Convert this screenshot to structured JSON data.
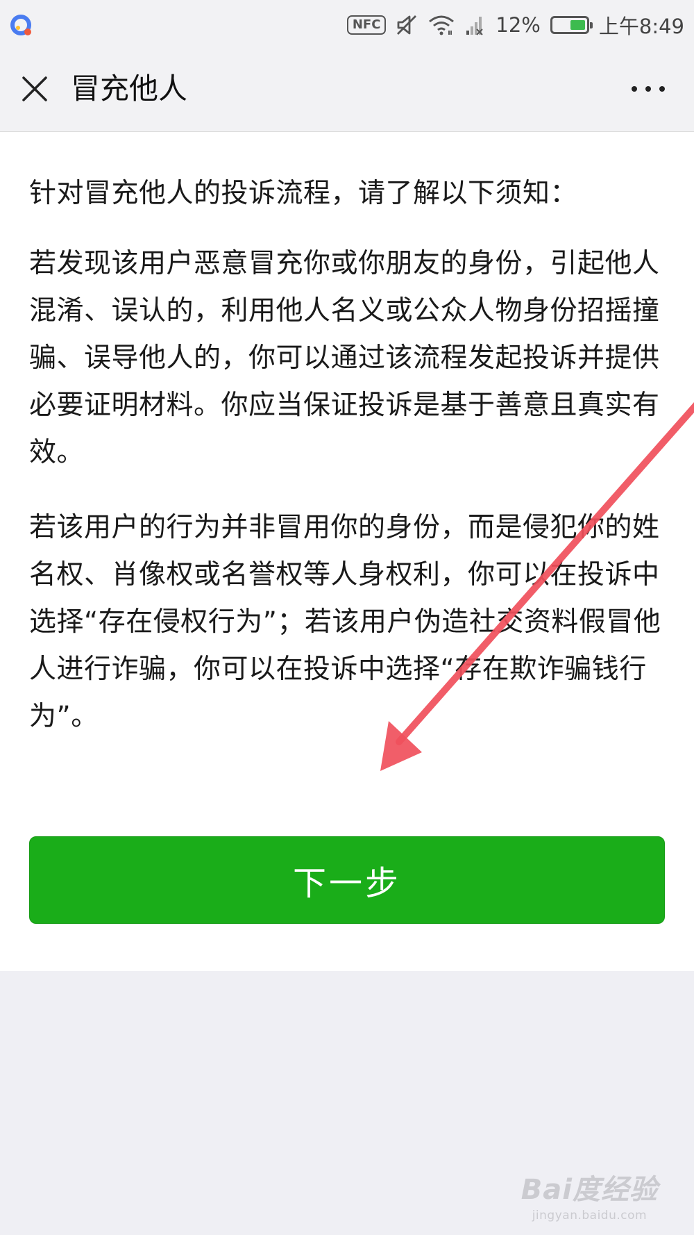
{
  "status_bar": {
    "nfc": "NFC",
    "battery_percent": "12%",
    "battery_level": 0.12,
    "time": "上午8:49",
    "icons": [
      "app-logo-icon",
      "mute-icon",
      "wifi-icon",
      "signal-icon",
      "battery-icon"
    ]
  },
  "nav": {
    "title": "冒充他人",
    "close_icon": "close-icon",
    "more_icon": "more-icon"
  },
  "content": {
    "intro": "针对冒充他人的投诉流程，请了解以下须知：",
    "paragraph1": "若发现该用户恶意冒充你或你朋友的身份，引起他人混淆、误认的，利用他人名义或公众人物身份招摇撞骗、误导他人的，你可以通过该流程发起投诉并提供必要证明材料。你应当保证投诉是基于善意且真实有效。",
    "paragraph2": "若该用户的行为并非冒用你的身份，而是侵犯你的姓名权、肖像权或名誉权等人身权利，你可以在投诉中选择“存在侵权行为”；若该用户伪造社交资料假冒他人进行诈骗，你可以在投诉中选择“存在欺诈骗钱行为”。"
  },
  "buttons": {
    "next_label": "下一步"
  },
  "watermark": {
    "logo": "Bai度经验",
    "url": "jingyan.baidu.com"
  },
  "colors": {
    "primary_green": "#1aad19",
    "annotation_arrow": "#f0505c",
    "page_background": "#efeff4"
  }
}
